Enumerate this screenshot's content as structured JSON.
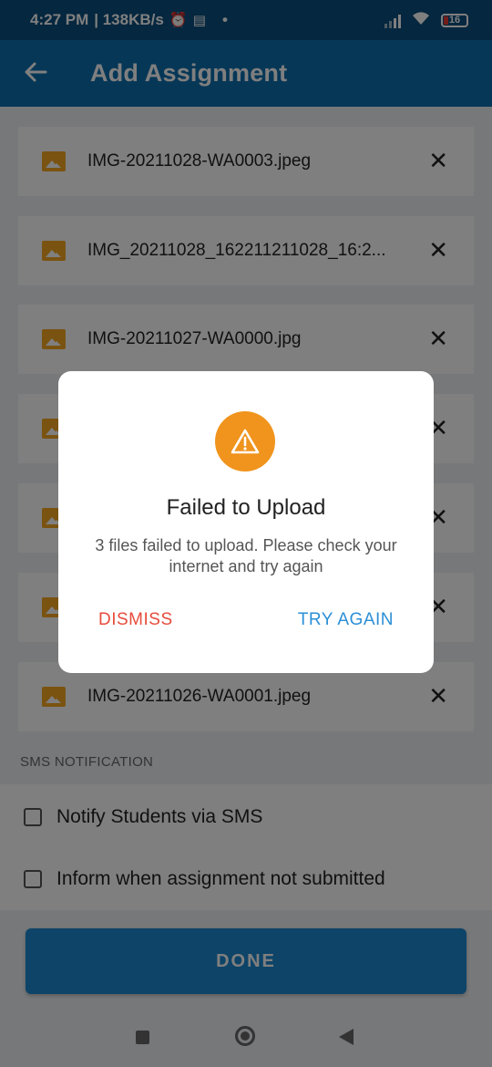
{
  "status_bar": {
    "time": "4:27 PM",
    "net_speed": "| 138KB/s",
    "battery_level": "16",
    "icons": [
      "alarm-icon",
      "message-icon",
      "dot-icon",
      "signal-icon",
      "wifi-icon",
      "battery-icon"
    ]
  },
  "app_bar": {
    "title": "Add Assignment",
    "back_icon": "arrow-back-icon"
  },
  "files": [
    {
      "name": "IMG-20211028-WA0003.jpeg"
    },
    {
      "name": "IMG_20211028_162211211028_16:2..."
    },
    {
      "name": "IMG-20211027-WA0000.jpg"
    },
    {
      "name": ""
    },
    {
      "name": ""
    },
    {
      "name": ""
    },
    {
      "name": "IMG-20211026-WA0001.jpeg"
    }
  ],
  "sms": {
    "section_label": "SMS NOTIFICATION",
    "options": [
      {
        "label": "Notify Students via SMS",
        "checked": false
      },
      {
        "label": "Inform when assignment not submitted",
        "checked": false
      }
    ]
  },
  "done_button": {
    "label": "DONE"
  },
  "dialog": {
    "title": "Failed to Upload",
    "message": "3 files failed to upload. Please check your internet and try again",
    "dismiss_label": "DISMISS",
    "try_again_label": "TRY AGAIN",
    "icon": "warning-icon"
  },
  "colors": {
    "app_bar": "#0d6fae",
    "warning": "#f0941d",
    "dismiss": "#e74c3c",
    "try_again": "#2b8fd6",
    "image_icon": "#f5a623"
  }
}
